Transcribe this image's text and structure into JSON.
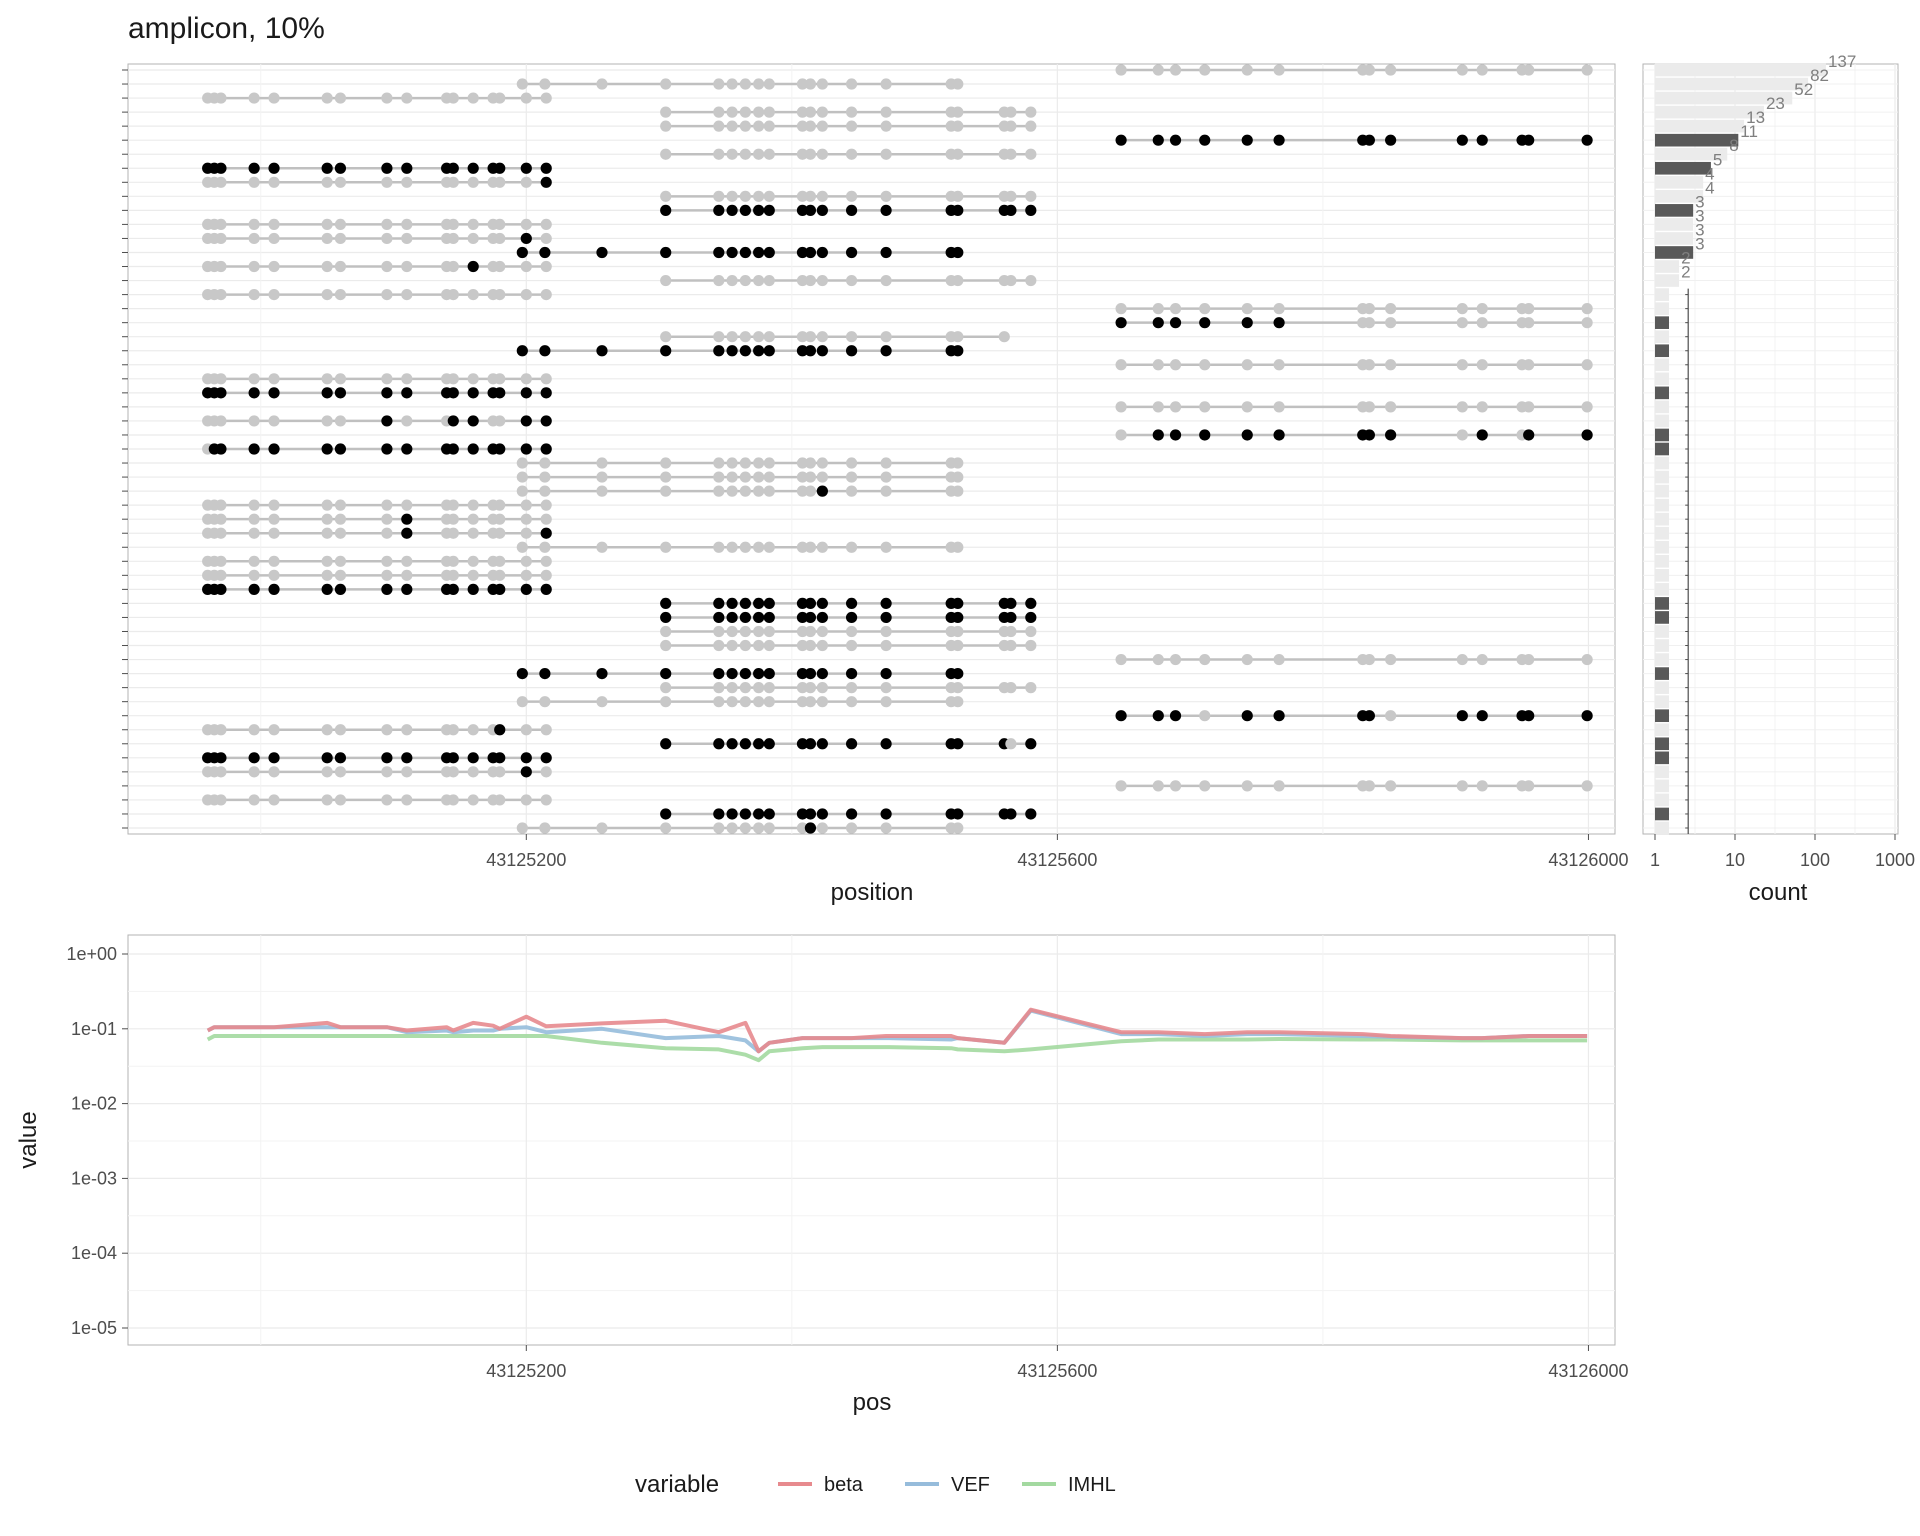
{
  "chart_data": [
    {
      "type": "scatter",
      "title": "amplicon, 10%",
      "xlabel": "position",
      "xlim": [
        43124900,
        43126020
      ],
      "xticks": [
        "43125200",
        "43125600",
        "43126000"
      ],
      "description_mode": "read-level methylation calls; black = methylated, grey = unmethylated",
      "colors": {
        "methylated": "#000000",
        "unmethylated": "#c8c8c8",
        "segment": "#c0c0c0"
      },
      "sites": {
        "L": [
          43124960,
          43124965,
          43124970,
          43124995,
          43125010,
          43125050,
          43125060,
          43125095,
          43125110,
          43125140,
          43125145,
          43125160,
          43125175,
          43125180,
          43125200,
          43125215
        ],
        "M": [
          43125197,
          43125214,
          43125257,
          43125305,
          43125345,
          43125355,
          43125365,
          43125375,
          43125383,
          43125408,
          43125414,
          43125423,
          43125445,
          43125471,
          43125520,
          43125525,
          43125560,
          43125565,
          43125580
        ],
        "R": [
          43125648,
          43125676,
          43125689,
          43125711,
          43125743,
          43125767,
          43125830,
          43125835,
          43125851,
          43125905,
          43125920,
          43125950,
          43125955,
          43125999
        ]
      },
      "reads": [
        {
          "g": "R",
          "m": [],
          "p": 0
        },
        {
          "g": "M",
          "m": [],
          "s": 0,
          "e": 15,
          "p": 1
        },
        {
          "g": "L",
          "m": [],
          "p": 2
        },
        {
          "g": "M",
          "m": [],
          "s": 3,
          "e": 18,
          "p": 3
        },
        {
          "g": "M",
          "m": [],
          "s": 3,
          "e": 18,
          "p": 4
        },
        {
          "g": "R",
          "m": "all",
          "p": 5
        },
        {
          "g": "M",
          "m": [],
          "s": 3,
          "e": 18,
          "p": 6
        },
        {
          "g": "L",
          "m": "all",
          "p": 7
        },
        {
          "g": "L",
          "m": [
            15
          ],
          "p": 8
        },
        {
          "g": "M",
          "m": [],
          "s": 3,
          "e": 18,
          "p": 9
        },
        {
          "g": "M",
          "m": "all",
          "s": 3,
          "e": 18,
          "p": 10
        },
        {
          "g": "L",
          "m": [],
          "p": 11
        },
        {
          "g": "L",
          "m": [
            14
          ],
          "p": 12
        },
        {
          "g": "M",
          "m": "all",
          "s": 0,
          "e": 15,
          "p": 13
        },
        {
          "g": "L",
          "m": [
            11
          ],
          "p": 14
        },
        {
          "g": "M",
          "m": [],
          "s": 3,
          "e": 18,
          "p": 15
        },
        {
          "g": "L",
          "m": [],
          "p": 16
        },
        {
          "g": "R",
          "m": [],
          "p": 17
        },
        {
          "g": "R",
          "m": [
            0,
            1,
            2,
            3,
            4,
            5
          ],
          "p": 18
        },
        {
          "g": "M",
          "m": [],
          "s": 3,
          "e": 16,
          "p": 19
        },
        {
          "g": "M",
          "m": "all",
          "s": 0,
          "e": 15,
          "p": 20
        },
        {
          "g": "R",
          "m": [],
          "p": 21
        },
        {
          "g": "L",
          "m": [],
          "p": 22
        },
        {
          "g": "L",
          "m": "all",
          "p": 23
        },
        {
          "g": "R",
          "m": [],
          "p": 24
        },
        {
          "g": "L",
          "m": [
            7,
            10,
            11,
            14,
            15
          ],
          "p": 25
        },
        {
          "g": "R",
          "m": [
            1,
            2,
            3,
            4,
            5,
            6,
            7,
            8,
            10,
            12,
            13
          ],
          "p": 26
        },
        {
          "g": "L",
          "m": [
            1,
            2,
            3,
            4,
            5,
            6,
            7,
            8,
            9,
            10,
            11,
            12,
            13,
            14,
            15
          ],
          "p": 27
        },
        {
          "g": "M",
          "m": [],
          "s": 0,
          "e": 15,
          "p": 28
        },
        {
          "g": "M",
          "m": [],
          "s": 0,
          "e": 15,
          "p": 29
        },
        {
          "g": "M",
          "m": [
            11
          ],
          "s": 0,
          "e": 15,
          "p": 30
        },
        {
          "g": "L",
          "m": [],
          "p": 31
        },
        {
          "g": "L",
          "m": [
            8
          ],
          "p": 32
        },
        {
          "g": "L",
          "m": [
            8,
            15
          ],
          "p": 33
        },
        {
          "g": "M",
          "m": [],
          "s": 0,
          "e": 15,
          "p": 34
        },
        {
          "g": "L",
          "m": [],
          "p": 35
        },
        {
          "g": "L",
          "m": [],
          "p": 36
        },
        {
          "g": "L",
          "m": "all",
          "p": 37
        },
        {
          "g": "M",
          "m": "all",
          "s": 3,
          "e": 18,
          "p": 38
        },
        {
          "g": "M",
          "m": "all",
          "s": 3,
          "e": 18,
          "p": 39
        },
        {
          "g": "M",
          "m": [],
          "s": 3,
          "e": 18,
          "p": 40
        },
        {
          "g": "M",
          "m": [],
          "s": 3,
          "e": 18,
          "p": 41
        },
        {
          "g": "R",
          "m": [],
          "p": 42
        },
        {
          "g": "M",
          "m": "all",
          "s": 0,
          "e": 15,
          "p": 43
        },
        {
          "g": "M",
          "m": [],
          "s": 3,
          "e": 18,
          "p": 44
        },
        {
          "g": "M",
          "m": [],
          "s": 0,
          "e": 15,
          "p": 45
        },
        {
          "g": "R",
          "m": [
            0,
            1,
            2,
            4,
            5,
            6,
            7,
            9,
            10,
            11,
            12,
            13
          ],
          "p": 46
        },
        {
          "g": "L",
          "m": [
            13
          ],
          "p": 47
        },
        {
          "g": "M",
          "m": [
            3,
            4,
            5,
            6,
            7,
            8,
            9,
            10,
            11,
            12,
            13,
            14,
            15,
            16,
            18
          ],
          "s": 3,
          "e": 18,
          "p": 48
        },
        {
          "g": "L",
          "m": [
            0,
            1,
            2,
            3,
            4,
            5,
            6,
            7,
            8,
            9,
            10,
            11,
            12,
            13,
            14,
            15
          ],
          "p": 49
        },
        {
          "g": "L",
          "m": [
            14
          ],
          "p": 50
        },
        {
          "g": "R",
          "m": [],
          "p": 51
        },
        {
          "g": "L",
          "m": [],
          "p": 52
        },
        {
          "g": "M",
          "m": "all",
          "s": 3,
          "e": 18,
          "p": 53
        },
        {
          "g": "M",
          "m": [
            10
          ],
          "s": 0,
          "e": 15,
          "p": 54
        }
      ]
    },
    {
      "type": "bar",
      "xlabel": "count",
      "xscale": "log10",
      "xlim": [
        1,
        1000
      ],
      "xticks": [
        "1",
        "10",
        "100",
        "1000"
      ],
      "labeled_counts": [
        137,
        82,
        52,
        23,
        13,
        11,
        8,
        5,
        4,
        4,
        3,
        3,
        3,
        3,
        2,
        2
      ],
      "rows": 55,
      "dark_rows": [
        5,
        7,
        10,
        13,
        18,
        20,
        23,
        26,
        27,
        38,
        39,
        43,
        46,
        48,
        49,
        53
      ],
      "colors": {
        "highlight": "#595959",
        "background": "#ebebeb"
      }
    },
    {
      "type": "line",
      "xlabel": "pos",
      "ylabel": "value",
      "yscale": "log10",
      "ylim": [
        1e-05,
        1
      ],
      "yticks": [
        "1e+00",
        "1e-01",
        "1e-02",
        "1e-03",
        "1e-04",
        "1e-05"
      ],
      "xticks": [
        "43125200",
        "43125600",
        "43126000"
      ],
      "legend": {
        "title": "variable",
        "position": "bottom"
      },
      "series": [
        {
          "name": "beta",
          "color": "#e78a8e",
          "x": [
            43124960,
            43124965,
            43125010,
            43125050,
            43125060,
            43125095,
            43125110,
            43125140,
            43125145,
            43125160,
            43125175,
            43125180,
            43125200,
            43125215,
            43125257,
            43125305,
            43125345,
            43125365,
            43125375,
            43125383,
            43125408,
            43125423,
            43125445,
            43125471,
            43125520,
            43125525,
            43125560,
            43125580,
            43125648,
            43125676,
            43125711,
            43125743,
            43125767,
            43125830,
            43125851,
            43125905,
            43125920,
            43125955,
            43125999
          ],
          "values": [
            0.095,
            0.105,
            0.105,
            0.12,
            0.105,
            0.105,
            0.095,
            0.105,
            0.095,
            0.12,
            0.11,
            0.1,
            0.145,
            0.108,
            0.118,
            0.128,
            0.09,
            0.12,
            0.05,
            0.065,
            0.075,
            0.075,
            0.075,
            0.08,
            0.08,
            0.075,
            0.065,
            0.18,
            0.09,
            0.09,
            0.085,
            0.09,
            0.09,
            0.085,
            0.08,
            0.075,
            0.075,
            0.08,
            0.08
          ]
        },
        {
          "name": "VEF",
          "color": "#96bcdb",
          "x": [
            43124960,
            43124965,
            43125010,
            43125050,
            43125060,
            43125095,
            43125110,
            43125140,
            43125145,
            43125160,
            43125175,
            43125180,
            43125200,
            43125215,
            43125257,
            43125305,
            43125345,
            43125365,
            43125375,
            43125383,
            43125408,
            43125423,
            43125445,
            43125471,
            43125520,
            43125525,
            43125560,
            43125580,
            43125648,
            43125676,
            43125711,
            43125743,
            43125767,
            43125830,
            43125851,
            43125905,
            43125920,
            43125955,
            43125999
          ],
          "values": [
            0.095,
            0.105,
            0.105,
            0.105,
            0.105,
            0.105,
            0.09,
            0.095,
            0.09,
            0.095,
            0.095,
            0.1,
            0.105,
            0.09,
            0.1,
            0.075,
            0.08,
            0.07,
            0.05,
            0.065,
            0.075,
            0.075,
            0.075,
            0.075,
            0.072,
            0.075,
            0.065,
            0.175,
            0.085,
            0.085,
            0.08,
            0.085,
            0.085,
            0.08,
            0.078,
            0.075,
            0.075,
            0.08,
            0.08
          ]
        },
        {
          "name": "IMHL",
          "color": "#a3d9a0",
          "x": [
            43124960,
            43124965,
            43125010,
            43125050,
            43125060,
            43125095,
            43125110,
            43125140,
            43125145,
            43125160,
            43125175,
            43125180,
            43125200,
            43125215,
            43125257,
            43125305,
            43125345,
            43125365,
            43125375,
            43125383,
            43125408,
            43125423,
            43125445,
            43125471,
            43125520,
            43125525,
            43125560,
            43125580,
            43125648,
            43125676,
            43125711,
            43125743,
            43125767,
            43125830,
            43125851,
            43125905,
            43125920,
            43125955,
            43125999
          ],
          "values": [
            0.072,
            0.08,
            0.08,
            0.08,
            0.08,
            0.08,
            0.08,
            0.08,
            0.08,
            0.08,
            0.08,
            0.08,
            0.08,
            0.08,
            0.065,
            0.055,
            0.053,
            0.045,
            0.038,
            0.05,
            0.055,
            0.057,
            0.057,
            0.057,
            0.055,
            0.053,
            0.05,
            0.053,
            0.068,
            0.072,
            0.072,
            0.072,
            0.073,
            0.072,
            0.072,
            0.07,
            0.07,
            0.07,
            0.07
          ]
        }
      ]
    }
  ]
}
